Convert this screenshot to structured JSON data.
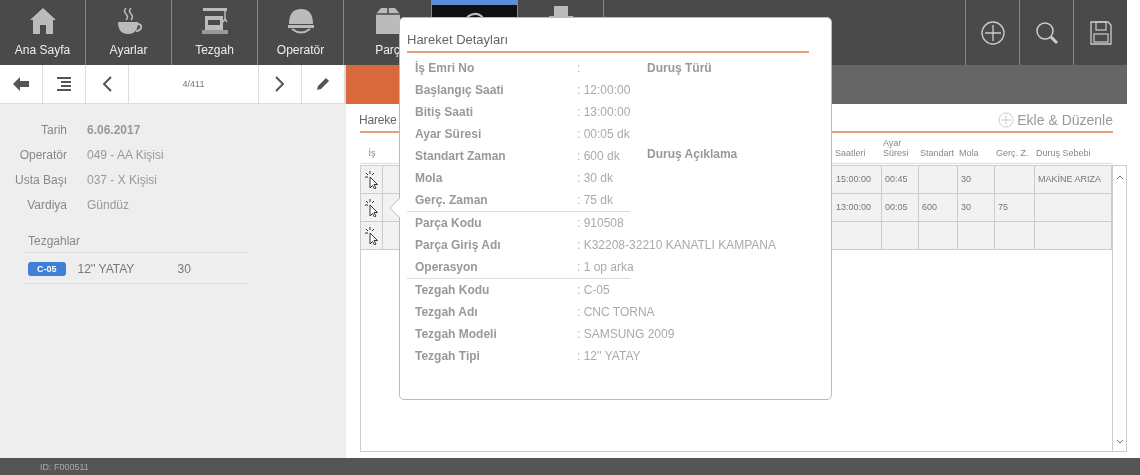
{
  "nav": [
    {
      "kind": "home",
      "label": "Ana Sayfa",
      "selected": false
    },
    {
      "kind": "cup",
      "label": "Ayarlar",
      "selected": false
    },
    {
      "kind": "machine",
      "label": "Tezgah",
      "selected": false
    },
    {
      "kind": "helmet",
      "label": "Operatör",
      "selected": false
    },
    {
      "kind": "box",
      "label": "Parç",
      "selected": false
    },
    {
      "kind": "refresh",
      "selected": true
    },
    {
      "kind": "printer",
      "selected": false
    }
  ],
  "actions": [
    {
      "kind": "add"
    },
    {
      "kind": "search"
    },
    {
      "kind": "save"
    }
  ],
  "toolbar": [
    {
      "kind": "back"
    },
    {
      "kind": "menu"
    },
    {
      "kind": "prev"
    },
    {
      "kind": "counter",
      "label": "4/411"
    },
    {
      "kind": "next"
    },
    {
      "kind": "edit"
    }
  ],
  "info": [
    {
      "label": "Tarih",
      "value": "6.06.2017",
      "bold": true
    },
    {
      "label": "Operatör",
      "value": "049 - AA Kişisi",
      "bold": false
    },
    {
      "label": "Usta Başı",
      "value": "037 - X Kişisi",
      "bold": false
    },
    {
      "label": "Vardiya",
      "value": "Gündüz",
      "bold": false
    }
  ],
  "machines": {
    "title": "Tezgahlar",
    "rows": [
      {
        "code": "C-05",
        "type": "12'' YATAY",
        "value": "30"
      }
    ]
  },
  "panel": {
    "title": "Hareke",
    "add_label": "Ekle & Düzenle"
  },
  "table": {
    "columns": [
      "İş",
      "",
      "Saatleri",
      "Ayar Süresi",
      "Standart",
      "Mola",
      "Gerç. Z.",
      "Duruş Sebebi"
    ],
    "rows": [
      [
        "",
        "",
        "15:00:00",
        "00:45",
        "",
        "30",
        "",
        "MAKİNE ARIZA"
      ],
      [
        "",
        "",
        "13:00:00",
        "00:05",
        "600",
        "30",
        "75",
        ""
      ],
      [
        "",
        "",
        "",
        "",
        "",
        "",
        "",
        ""
      ]
    ]
  },
  "popover": {
    "title": "Hareket Detayları",
    "groups": [
      [
        {
          "label": "İş Emri No",
          "value": ":"
        },
        {
          "label": "Başlangıç Saati",
          "value": ": 12:00:00"
        },
        {
          "label": "Bitiş Saati",
          "value": ": 13:00:00"
        },
        {
          "label": "Ayar Süresi",
          "value": ": 00:05 dk"
        },
        {
          "label": "Standart Zaman",
          "value": ": 600 dk"
        },
        {
          "label": "Mola",
          "value": ": 30 dk"
        },
        {
          "label": "Gerç. Zaman",
          "value": ": 75 dk"
        }
      ],
      [
        {
          "label": "Parça Kodu",
          "value": ": 910508"
        },
        {
          "label": "Parça Giriş Adı",
          "value": ": K32208-32210 KANATLI KAMPANA"
        },
        {
          "label": "Operasyon",
          "value": ": 1 op arka"
        }
      ],
      [
        {
          "label": "Tezgah Kodu",
          "value": ": C-05"
        },
        {
          "label": "Tezgah Adı",
          "value": ": CNC TORNA"
        },
        {
          "label": "Tezgah Modeli",
          "value": ": SAMSUNG 2009"
        },
        {
          "label": "Tezgah Tipi",
          "value": ": 12'' YATAY"
        }
      ]
    ],
    "side": [
      "Duruş Türü",
      "Duruş Açıklama"
    ]
  },
  "footer": "ID: F000511"
}
